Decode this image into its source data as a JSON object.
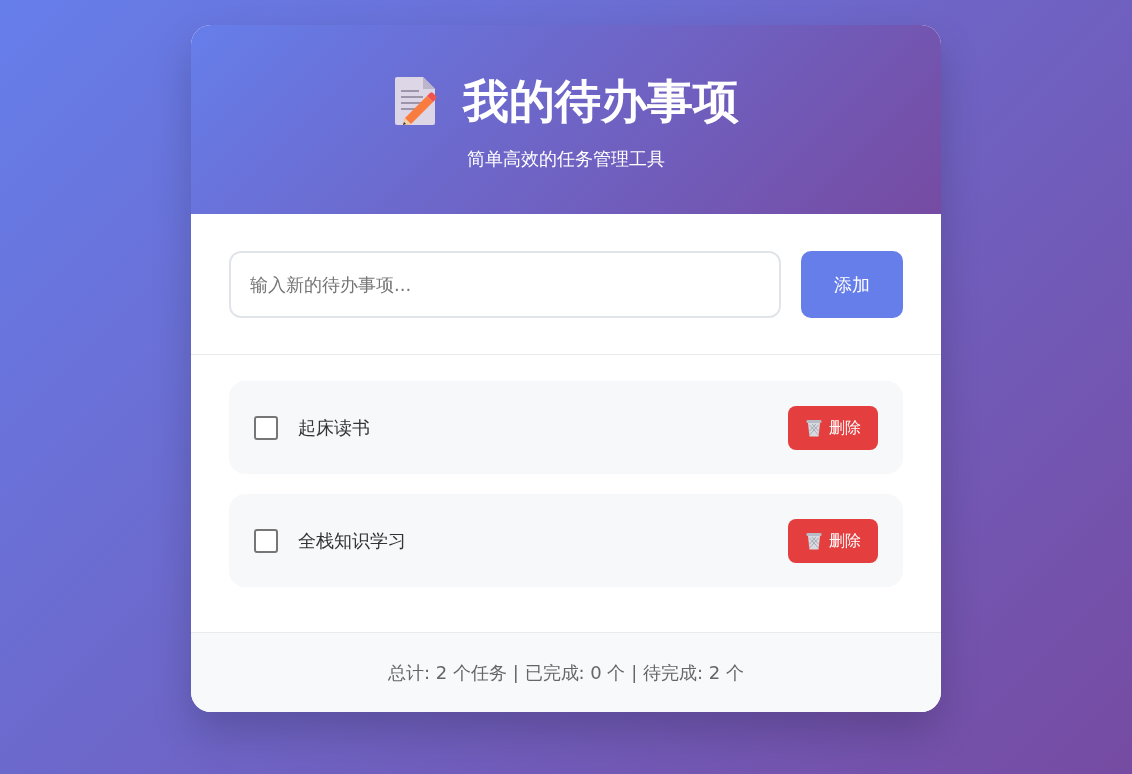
{
  "header": {
    "title": "我的待办事项",
    "subtitle": "简单高效的任务管理工具"
  },
  "new_todo": {
    "placeholder": "输入新的待办事项...",
    "button": "添加"
  },
  "todos": [
    {
      "text": "起床读书",
      "checked": false,
      "delete_button": "删除"
    },
    {
      "text": "全栈知识学习",
      "checked": false,
      "delete_button": "删除"
    }
  ],
  "footer": {
    "summary": "总计: 2 个任务 | 已完成: 0 个 | 待完成: 2 个"
  }
}
